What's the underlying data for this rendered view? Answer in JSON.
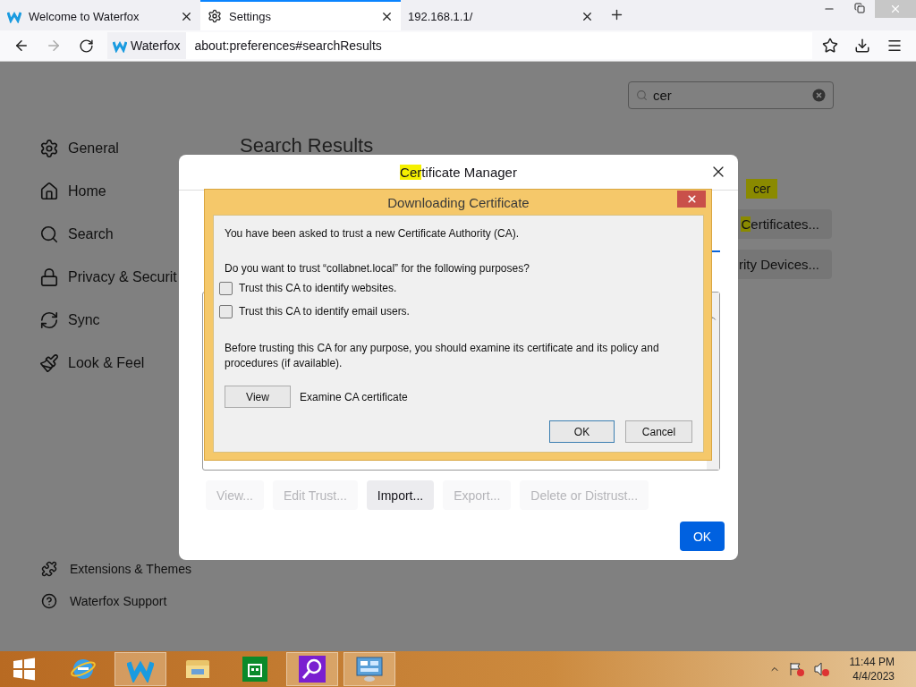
{
  "tabs": [
    {
      "title": "Welcome to Waterfox",
      "kind": "waterfox",
      "selected": false
    },
    {
      "title": "Settings",
      "kind": "gear",
      "selected": true
    },
    {
      "title": "192.168.1.1/",
      "kind": "none",
      "selected": false
    }
  ],
  "toolbar": {
    "identity": "Waterfox",
    "url": "about:preferences#searchResults"
  },
  "sidebar": {
    "items": [
      {
        "label": "General",
        "kind": "gear"
      },
      {
        "label": "Home",
        "kind": "home"
      },
      {
        "label": "Search",
        "kind": "search"
      },
      {
        "label": "Privacy & Securit",
        "kind": "lock"
      },
      {
        "label": "Sync",
        "kind": "sync"
      },
      {
        "label": "Look & Feel",
        "kind": "brush"
      }
    ],
    "footer": [
      {
        "label": "Extensions & Themes",
        "kind": "puzzle"
      },
      {
        "label": "Waterfox Support",
        "kind": "help"
      }
    ]
  },
  "search": {
    "value": "cer"
  },
  "results": {
    "heading": "Search Results",
    "tooltip": "cer",
    "buttons": [
      {
        "match": "C",
        "label": "ertificates..."
      },
      {
        "label": "rity Devices..."
      }
    ]
  },
  "certificate_manager": {
    "title_match": "Cer",
    "title_rest": "tificate Manager",
    "buttons": [
      {
        "label": "View...",
        "disabled": true
      },
      {
        "label": "Edit Trust...",
        "disabled": true
      },
      {
        "label": "Import...",
        "disabled": false
      },
      {
        "label": "Export...",
        "disabled": true
      },
      {
        "label": "Delete or Distrust...",
        "disabled": true
      }
    ],
    "ok": "OK"
  },
  "download_dialog": {
    "title": "Downloading Certificate",
    "intro": "You have been asked to trust a new Certificate Authority (CA).",
    "question": "Do you want to trust “collabnet.local” for the following purposes?",
    "options": [
      {
        "label": "Trust this CA to identify websites.",
        "checked": false
      },
      {
        "label": "Trust this CA to identify email users.",
        "checked": false
      }
    ],
    "note": "Before trusting this CA for any purpose, you should examine its certificate and its policy and procedures (if available).",
    "view_button": "View",
    "view_caption": "Examine CA certificate",
    "ok": "OK",
    "cancel": "Cancel"
  },
  "taskbar": {
    "apps": [
      {
        "kind": "ie",
        "active": false
      },
      {
        "kind": "waterfox",
        "active": true
      },
      {
        "kind": "folder",
        "active": false
      },
      {
        "kind": "store",
        "active": false
      },
      {
        "kind": "magnifier",
        "active": true
      },
      {
        "kind": "control",
        "active": true
      }
    ],
    "time": "11:44 PM",
    "date": "4/4/2023"
  }
}
